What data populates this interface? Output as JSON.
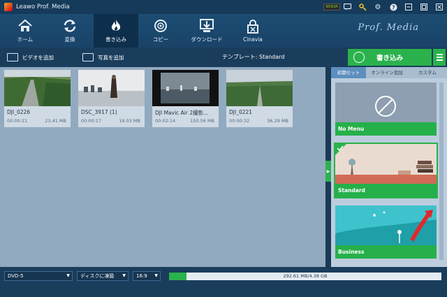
{
  "app": {
    "title": "Leawo Prof. Media",
    "brand": "Prof. Media"
  },
  "titlebar_icons": [
    "nvidia-icon",
    "chat-icon",
    "key-icon",
    "gear-icon",
    "help-icon",
    "minimize-icon",
    "maximize-icon",
    "close-icon"
  ],
  "titlebar": {
    "badge_text": "NVIDIA"
  },
  "toolbar": {
    "items": [
      {
        "label": "ホーム",
        "icon": "home-icon"
      },
      {
        "label": "変換",
        "icon": "convert-icon"
      },
      {
        "label": "書き込み",
        "icon": "burn-flame-icon",
        "active": true
      },
      {
        "label": "コピー",
        "icon": "disc-copy-icon"
      },
      {
        "label": "ダウンロード",
        "icon": "download-icon"
      },
      {
        "label": "Cinavia",
        "icon": "cinavia-lock-icon"
      }
    ]
  },
  "subbar": {
    "add_video": "ビデオを追加",
    "add_photo": "写真を追加",
    "template": "テンプレート: Standard",
    "burn_button": "書き込み"
  },
  "clips": [
    {
      "name": "DJI_0226",
      "duration": "00:00:21",
      "size": "23.41 MB"
    },
    {
      "name": "DSC_3917 (1)",
      "duration": "00:00:17",
      "size": "19.03 MB"
    },
    {
      "name": "DJI Mavic Air 2撮影...",
      "duration": "00:02:14",
      "size": "150.56 MB"
    },
    {
      "name": "DJI_0221",
      "duration": "00:00:32",
      "size": "36.29 MB"
    }
  ],
  "rightpanel": {
    "tabs": [
      "初期セット",
      "オンライン追加",
      "カスタム"
    ],
    "templates": [
      {
        "name": "No Menu"
      },
      {
        "name": "Standard",
        "selected": true
      },
      {
        "name": "Business"
      }
    ]
  },
  "bottombar": {
    "disc_type": "DVD-5",
    "fit_mode": "ディスクに凍扱",
    "aspect": "16:9",
    "usage": "292.61 MB/4.38 GB",
    "progress_fraction": 0.065
  },
  "colors": {
    "accent_green": "#2bb24c",
    "toolbar_blue": "#1c4c72",
    "content_bg": "#92aac0"
  }
}
